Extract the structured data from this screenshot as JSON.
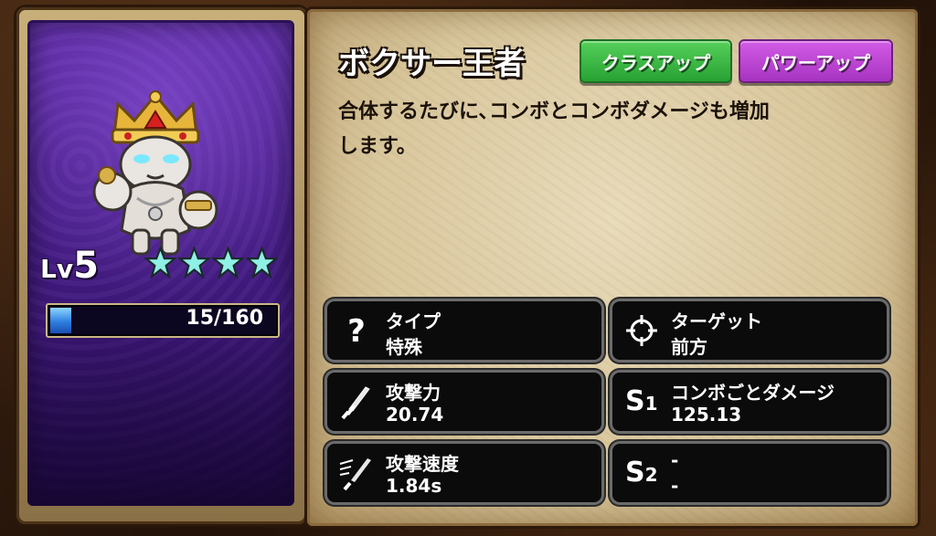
{
  "unit": {
    "name": "ボクサー王者",
    "level_label": "Lv",
    "level": "5",
    "stars": 4,
    "xp_text": "15/160",
    "xp_fraction": 0.094
  },
  "buttons": {
    "class_up": "クラスアップ",
    "power_up": "パワーアップ"
  },
  "description": {
    "line1": "合体するたびに､コンボとコンボダメージも増加",
    "line2": "します。"
  },
  "stats": {
    "type": {
      "name": "タイプ",
      "value": "特殊",
      "icon": "question-icon"
    },
    "target": {
      "name": "ターゲット",
      "value": "前方",
      "icon": "crosshair-icon"
    },
    "attack": {
      "name": "攻撃力",
      "value": "20.74",
      "icon": "sword-icon"
    },
    "skill1": {
      "label": "S",
      "sub": "1",
      "name": "コンボごとダメージ",
      "value": "125.13"
    },
    "attack_speed": {
      "name": "攻撃速度",
      "value": "1.84s",
      "icon": "fast-sword-icon"
    },
    "skill2": {
      "label": "S",
      "sub": "2",
      "name": "-",
      "value": "-"
    }
  },
  "colors": {
    "card_purple": "#4a1f8c",
    "button_green": "#27a233",
    "button_purple": "#a733c1",
    "star": "#8ff0e6",
    "xp_blue": "#2e7fe0"
  }
}
